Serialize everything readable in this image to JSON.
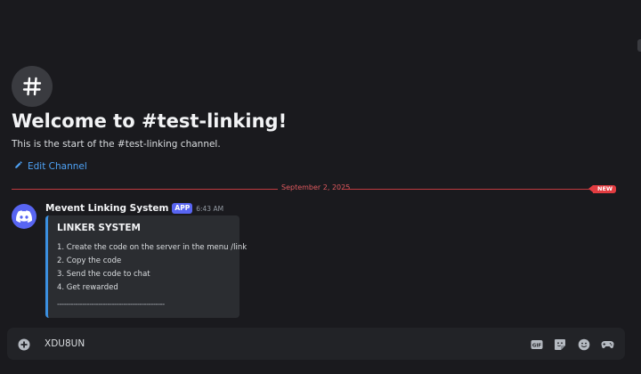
{
  "channel": {
    "icon": "hash-icon",
    "welcome_title": "Welcome to #test-linking!",
    "welcome_subtitle": "This is the start of the #test-linking channel.",
    "edit_label": "Edit Channel",
    "edit_icon": "pencil-icon"
  },
  "divider": {
    "date": "September 2, 2025",
    "new_badge": "NEW",
    "color": "#e23c41"
  },
  "message": {
    "avatar_icon": "discord-icon",
    "author": "Mevent Linking System",
    "badge": "APP",
    "timestamp": "6:43 AM",
    "embed": {
      "title": "LINKER SYSTEM",
      "lines": [
        "1. Create the code on the server in the menu /link",
        "2. Copy the code",
        "3. Send the code to chat",
        "4. Get rewarded"
      ],
      "rule": "-----------------------------------------------",
      "accent_color": "#3b8fe0"
    }
  },
  "composer": {
    "value": "XDU8UN",
    "add_icon": "plus-circle-icon",
    "icons": [
      "gif-icon",
      "sticker-icon",
      "emoji-icon",
      "gamepad-icon"
    ]
  },
  "colors": {
    "background": "#1a1a1e",
    "brand": "#5865f2",
    "link": "#4ea2f5"
  }
}
